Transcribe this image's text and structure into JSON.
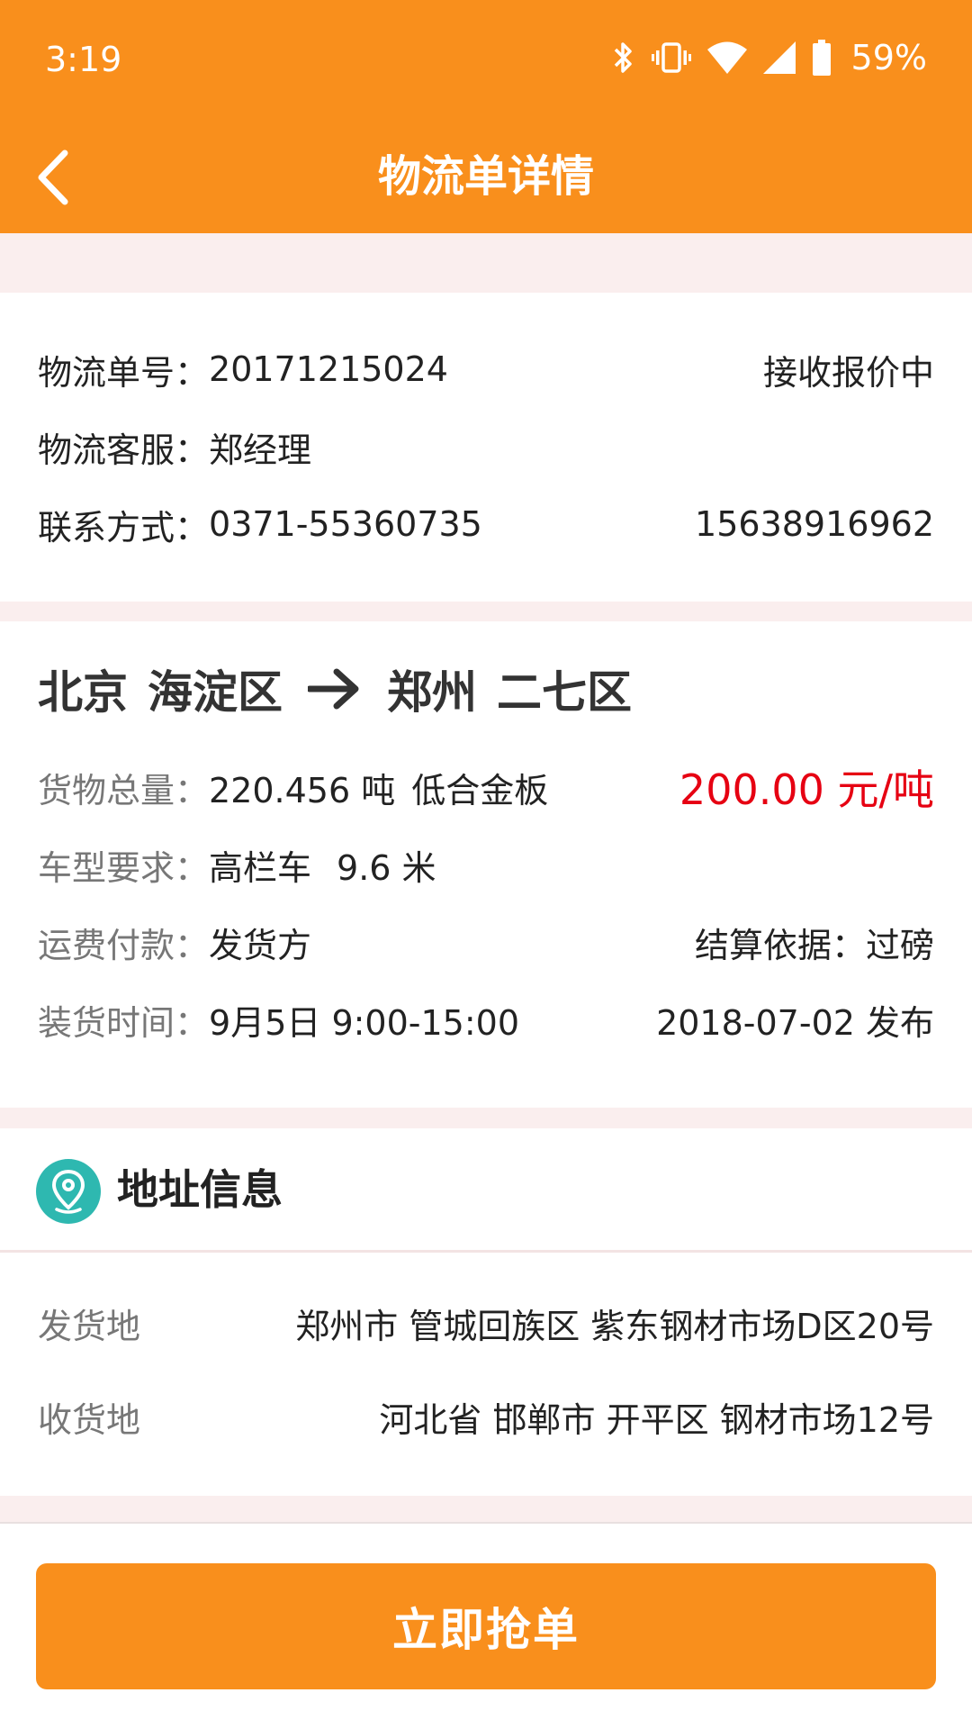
{
  "status_bar": {
    "time": "3:19",
    "battery": "59%",
    "icons": [
      "bluetooth-icon",
      "vibrate-icon",
      "wifi-icon",
      "signal-icon",
      "battery-icon"
    ]
  },
  "header": {
    "title": "物流单详情",
    "back_icon": "chevron-left-icon"
  },
  "order": {
    "number_label": "物流单号：",
    "number": "20171215024",
    "status": "接收报价中",
    "service_label": "物流客服：",
    "service": "郑经理",
    "contact_label": "联系方式：",
    "phone": "0371-55360735",
    "mobile": "15638916962"
  },
  "route": {
    "from_city": "北京",
    "from_district": "海淀区",
    "to_city": "郑州",
    "to_district": "二七区"
  },
  "cargo": {
    "weight_label": "货物总量：",
    "weight": "220.456 吨",
    "goods": "低合金板",
    "price": "200.00 元/吨",
    "vehicle_label": "车型要求：",
    "vehicle_type": "高栏车",
    "vehicle_length": "9.6 米",
    "payment_label": "运费付款：",
    "payment": "发货方",
    "settle_label": "结算依据：",
    "settle": "过磅",
    "loading_label": "装货时间：",
    "loading_time": "9月5日 9:00-15:00",
    "publish": "2018-07-02 发布"
  },
  "address": {
    "title": "地址信息",
    "icon": "location-pin-icon",
    "from_label": "发货地",
    "from": "郑州市 管城回族区 紫东钢材市场D区20号",
    "to_label": "收货地",
    "to": "河北省 邯郸市 开平区 钢材市场12号"
  },
  "action": {
    "button_label": "立即抢单"
  },
  "colors": {
    "accent": "#f98f1c",
    "price": "#e60012",
    "icon_teal": "#2eb8b0",
    "background": "#faeeee"
  }
}
